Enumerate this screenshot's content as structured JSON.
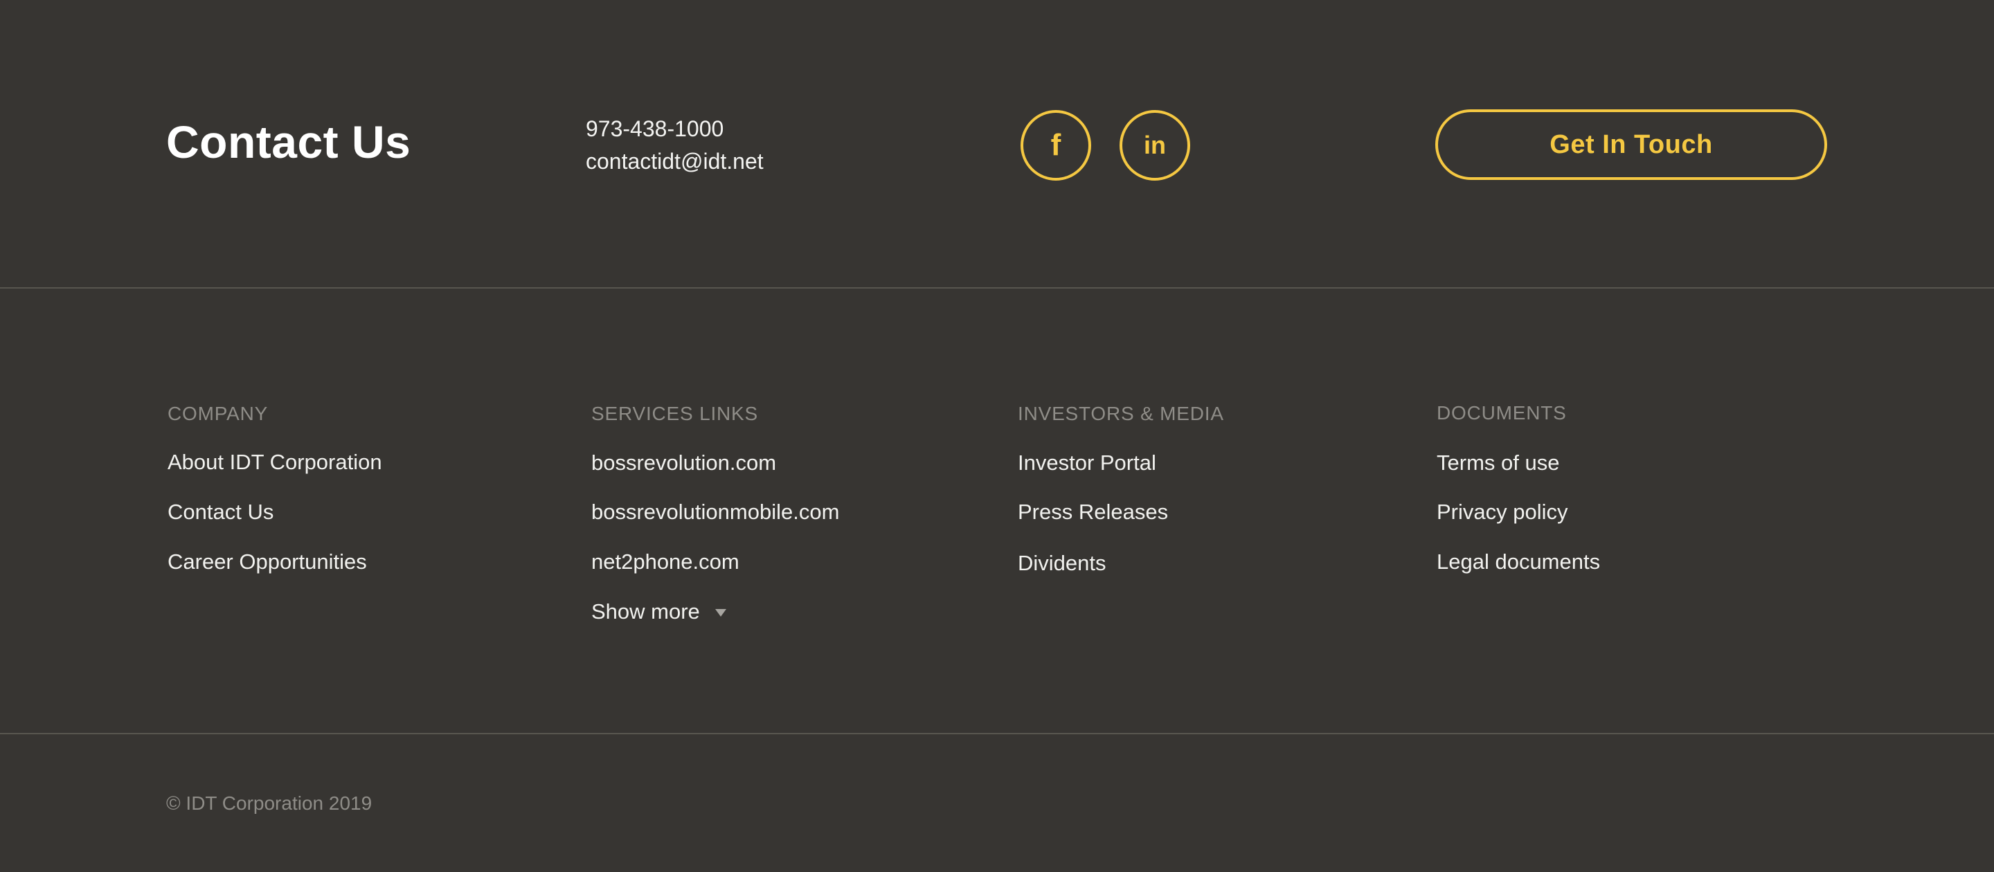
{
  "contact": {
    "title": "Contact Us",
    "phone": "973-438-1000",
    "email": "contactidt@idt.net",
    "cta_label": "Get In Touch"
  },
  "social": {
    "facebook_glyph": "f",
    "linkedin_glyph": "in",
    "facebook_icon": "facebook-icon",
    "linkedin_icon": "linkedin-icon",
    "accent_color": "#f5c842"
  },
  "columns": {
    "company": {
      "heading": "COMPANY",
      "links": [
        "About IDT Corporation",
        "Contact Us",
        "Career Opportunities"
      ]
    },
    "services": {
      "heading": "SERVICES LINKS",
      "links": [
        "bossrevolution.com",
        "bossrevolutionmobile.com",
        "net2phone.com"
      ],
      "show_more": "Show more"
    },
    "investors": {
      "heading": "INVESTORS & MEDIA",
      "links": [
        "Investor Portal",
        "Press Releases",
        "Dividents"
      ]
    },
    "documents": {
      "heading": "DOCUMENTS",
      "links": [
        "Terms of use",
        "Privacy policy",
        "Legal documents"
      ]
    }
  },
  "footer": {
    "copyright": "© IDT Corporation 2019"
  },
  "colors": {
    "background": "#373532",
    "divider": "#58564f",
    "muted_text": "#8f8d88"
  }
}
